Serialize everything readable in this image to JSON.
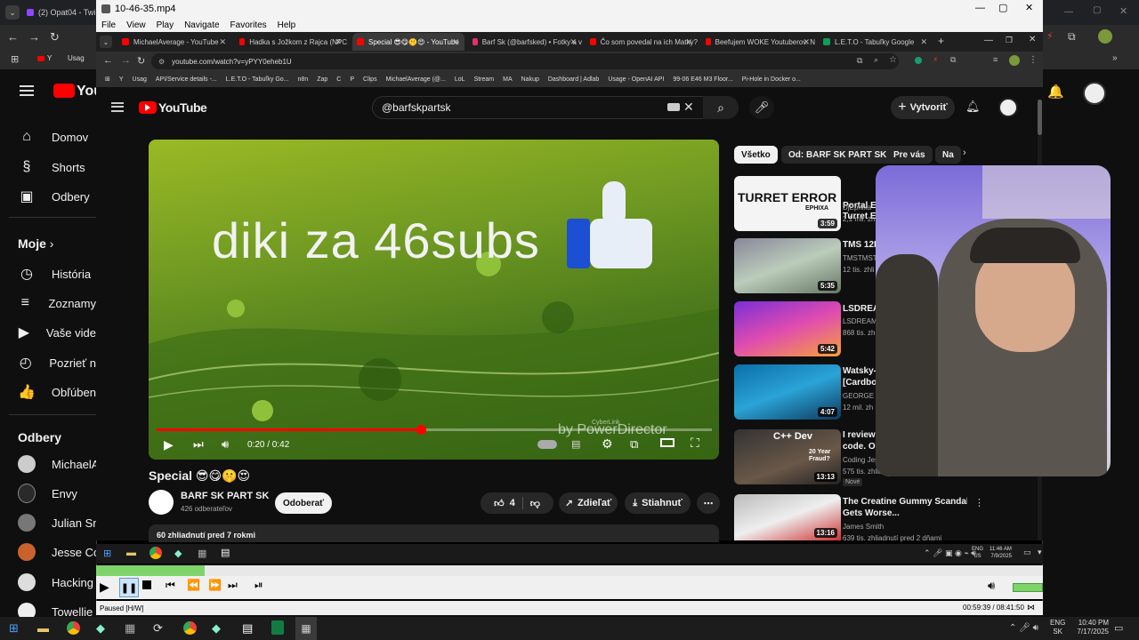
{
  "outer_browser": {
    "tabs": [
      {
        "label": "(2) Opat04 - Twi"
      }
    ],
    "bookmarks": [
      {
        "label": "Y"
      },
      {
        "label": "Usag"
      }
    ],
    "sidebar": {
      "items": [
        {
          "label": "Domov",
          "icon": "home-icon"
        },
        {
          "label": "Shorts",
          "icon": "shorts-icon"
        },
        {
          "label": "Odbery",
          "icon": "subscriptions-icon"
        }
      ],
      "section_you": "Moje",
      "you_items": [
        {
          "label": "História"
        },
        {
          "label": "Zoznamy"
        },
        {
          "label": "Vaše vide"
        },
        {
          "label": "Pozrieť n"
        },
        {
          "label": "Obľúbené"
        }
      ],
      "section_subs": "Odbery",
      "subs": [
        {
          "label": "MichaelA"
        },
        {
          "label": "Envy"
        },
        {
          "label": "Julian Sn"
        },
        {
          "label": "Jesse Co"
        },
        {
          "label": "Hacking"
        },
        {
          "label": "Towellie"
        }
      ]
    }
  },
  "player": {
    "title": "10-46-35.mp4",
    "menu": [
      "File",
      "View",
      "Play",
      "Navigate",
      "Favorites",
      "Help"
    ],
    "status": "Paused [H/W]",
    "time": "00:59:39 / 08:41:50",
    "progress": 0.115
  },
  "inner_browser": {
    "tabs": [
      {
        "label": "MichaelAverage - YouTube",
        "color": "#ff0000"
      },
      {
        "label": "Hadka s Jožkom z Rajca (NPC",
        "color": "#ff0000"
      },
      {
        "label": "Special 😎😋🤫😍 - YouTube",
        "color": "#ff0000",
        "active": true
      },
      {
        "label": "Barf Sk (@barfsked) • Fotky a v",
        "color": "#e1306c"
      },
      {
        "label": "Čo som povedal na ich Matky?",
        "color": "#ff0000"
      },
      {
        "label": "Beefujem WOKE Youtuberov. N",
        "color": "#ff0000"
      },
      {
        "label": "L.E.T.O - Tabuľky Google",
        "color": "#0f9d58"
      }
    ],
    "url": "youtube.com/watch?v=yPYY0eheb1U",
    "bookmarks": [
      "Y",
      "Usag",
      "API/Service details -...",
      "L.E.T.O - Tabuľky Go...",
      "n8n",
      "Zap",
      "C",
      "P",
      "Clips",
      "MichaelAverage (@...",
      "LoL",
      "Stream",
      "MA",
      "Nakup",
      "Dashboard | Adlab",
      "Usage - OpenAI API",
      "99-06 E46 M3 Floor...",
      "Pi-Hole in Docker o..."
    ]
  },
  "youtube": {
    "logo": "YouTube",
    "search_value": "@barfskpartsk",
    "create_label": "Vytvoriť",
    "video_text": "diki za 46subs",
    "watermark": "by PowerDirector",
    "watermark_small": "CyberLink",
    "time": "0:20 / 0:42",
    "video_progress": 0.476,
    "title": "Special 😎😋🤫😍",
    "channel": "BARF SK PART SK",
    "subscribers": "426 odberateľov",
    "subscribe_label": "Odoberať",
    "likes": "4",
    "share_label": "Zdieľať",
    "download_label": "Stiahnuť",
    "views": "60 zhliadnutí  pred 7 rokmi",
    "chips": [
      "Všetko",
      "Od: BARF SK PART SK",
      "Pre vás",
      "Na"
    ],
    "recommendations": [
      {
        "title": "Portal Er",
        "subtitle": "Turret Er",
        "channel": "DjEphixa",
        "meta": "2,1 mil. zh",
        "duration": "3:59",
        "thumb_text": "TURRET ERROR",
        "thumb_sub": "EPHIXA"
      },
      {
        "title": "TMS 12B",
        "channel": "TMSTMST",
        "meta": "12 tis. zhli",
        "duration": "5:35"
      },
      {
        "title": "LSDREA",
        "channel": "LSDREAM",
        "meta": "868 tis. zh",
        "duration": "5:42"
      },
      {
        "title": "Watsky-",
        "subtitle": "[Cardbo",
        "channel": "GEORGE W",
        "meta": "12 mil. zh",
        "duration": "4:07"
      },
      {
        "title": "I reviewed Pirate Softwa",
        "subtitle": "code. Oh boy...",
        "channel": "Coding Jesus",
        "meta": "575 tis. zhliadnutí  pred 1 d",
        "duration": "13:13",
        "badge": "Nové",
        "thumb_text": "C++ Dev",
        "thumb_sub": "20 Year Fraud?"
      },
      {
        "title": "The Creatine Gummy Scandal",
        "subtitle": "Gets Worse...",
        "channel": "James Smith",
        "meta": "639 tis. zhliadnutí  pred 2 dňami",
        "duration": "13:16"
      }
    ]
  },
  "player_taskbar": {
    "lang": "ENG",
    "lang2": "US",
    "time": "11:46 AM",
    "date": "7/9/2025"
  },
  "taskbar": {
    "lang": "ENG",
    "lang2": "SK",
    "time": "10:40 PM",
    "date": "7/17/2025"
  }
}
